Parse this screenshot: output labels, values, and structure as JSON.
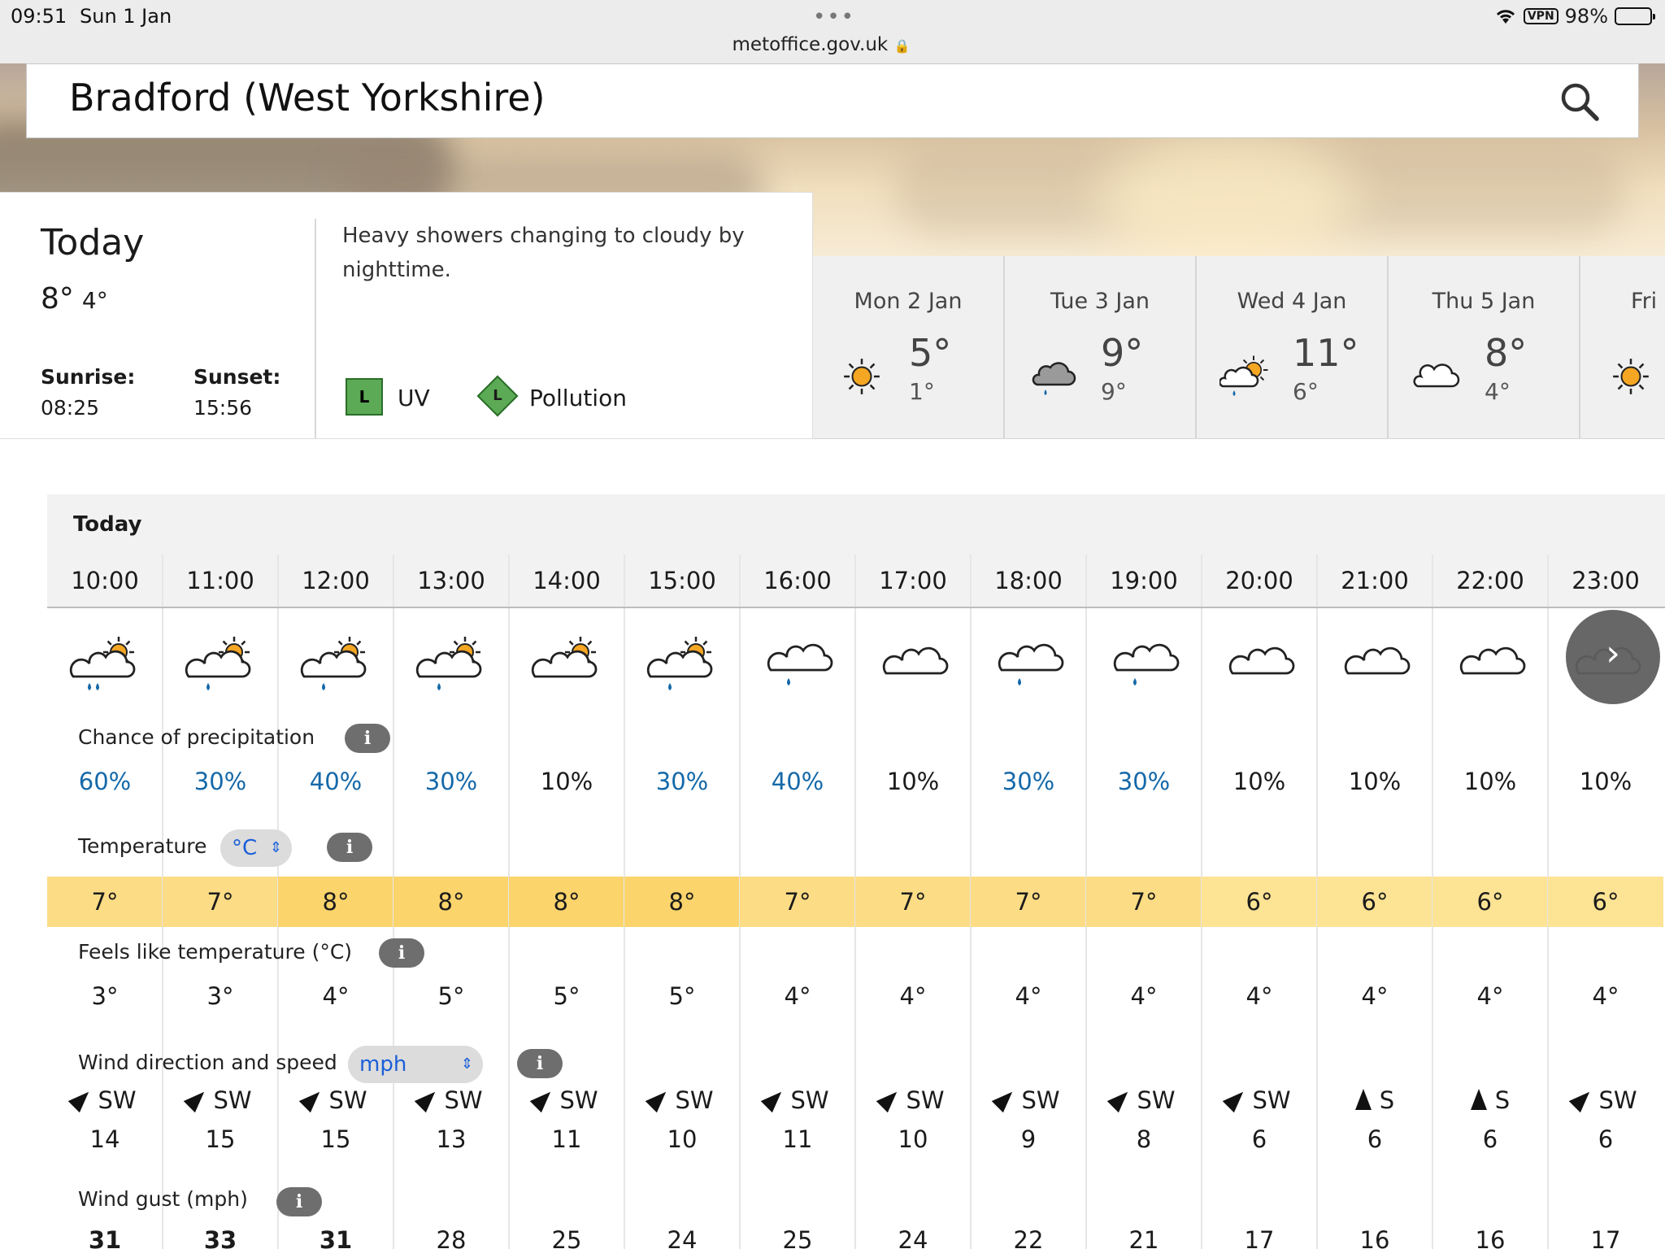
{
  "status_bar": {
    "time": "09:51",
    "date": "Sun 1 Jan",
    "dots": "•••",
    "url": "metoffice.gov.uk",
    "vpn": "VPN",
    "battery": "98%"
  },
  "search": {
    "location": "Bradford (West Yorkshire)"
  },
  "today": {
    "title": "Today",
    "high": "8°",
    "low": "4°",
    "sunrise_label": "Sunrise:",
    "sunrise": "08:25",
    "sunset_label": "Sunset:",
    "sunset": "15:56",
    "summary": "Heavy showers changing to cloudy by nighttime.",
    "uv_level": "L",
    "uv_label": "UV",
    "pollution_level": "L",
    "pollution_label": "Pollution"
  },
  "days": [
    {
      "name": "Mon 2 Jan",
      "high": "5°",
      "low": "1°",
      "icon": "sunny-icon"
    },
    {
      "name": "Tue 3 Jan",
      "high": "9°",
      "low": "9°",
      "icon": "rain-cloud-icon"
    },
    {
      "name": "Wed 4 Jan",
      "high": "11°",
      "low": "6°",
      "icon": "sunny-shower-icon"
    },
    {
      "name": "Thu 5 Jan",
      "high": "8°",
      "low": "4°",
      "icon": "cloud-icon"
    },
    {
      "name": "Fri (",
      "high": "",
      "low": "",
      "icon": "sunny-icon"
    }
  ],
  "hourly": {
    "title": "Today",
    "times": [
      "10:00",
      "11:00",
      "12:00",
      "13:00",
      "14:00",
      "15:00",
      "16:00",
      "17:00",
      "18:00",
      "19:00",
      "20:00",
      "21:00",
      "22:00",
      "23:00"
    ],
    "icons": [
      "sunny-shower-heavy-icon",
      "sunny-shower-icon",
      "sunny-shower-icon",
      "sunny-shower-icon",
      "sunny-cloud-icon",
      "sunny-shower-icon",
      "cloud-shower-icon",
      "cloud-icon",
      "cloud-shower-icon",
      "cloud-shower-icon",
      "cloud-icon",
      "cloud-icon",
      "cloud-icon",
      "cloud-icon"
    ],
    "precip_label": "Chance of precipitation",
    "precip": [
      "60%",
      "30%",
      "40%",
      "30%",
      "10%",
      "30%",
      "40%",
      "10%",
      "30%",
      "30%",
      "10%",
      "10%",
      "10%",
      "10%"
    ],
    "temp_label": "Temperature",
    "temp_unit": "°C",
    "temps": [
      "7°",
      "7°",
      "8°",
      "8°",
      "8°",
      "8°",
      "7°",
      "7°",
      "7°",
      "7°",
      "6°",
      "6°",
      "6°",
      "6°"
    ],
    "feels_label": "Feels like temperature (°C)",
    "feels": [
      "3°",
      "3°",
      "4°",
      "5°",
      "5°",
      "5°",
      "4°",
      "4°",
      "4°",
      "4°",
      "4°",
      "4°",
      "4°",
      "4°"
    ],
    "wind_label": "Wind direction and speed",
    "wind_unit": "mph",
    "wind_dir": [
      "SW",
      "SW",
      "SW",
      "SW",
      "SW",
      "SW",
      "SW",
      "SW",
      "SW",
      "SW",
      "SW",
      "S",
      "S",
      "SW"
    ],
    "wind_speed": [
      "14",
      "15",
      "15",
      "13",
      "11",
      "10",
      "11",
      "10",
      "9",
      "8",
      "6",
      "6",
      "6",
      "6"
    ],
    "gust_label": "Wind gust (mph)",
    "gusts": [
      "31",
      "33",
      "31",
      "28",
      "25",
      "24",
      "25",
      "24",
      "22",
      "21",
      "17",
      "16",
      "16",
      "17"
    ],
    "info": "i",
    "next": "›"
  },
  "colors": {
    "temp_8": "#fbd46c",
    "temp_7": "#fcdc85",
    "temp_6": "#fde394",
    "precip_blue": "#1569a9",
    "uv_green": "#5caa55"
  }
}
